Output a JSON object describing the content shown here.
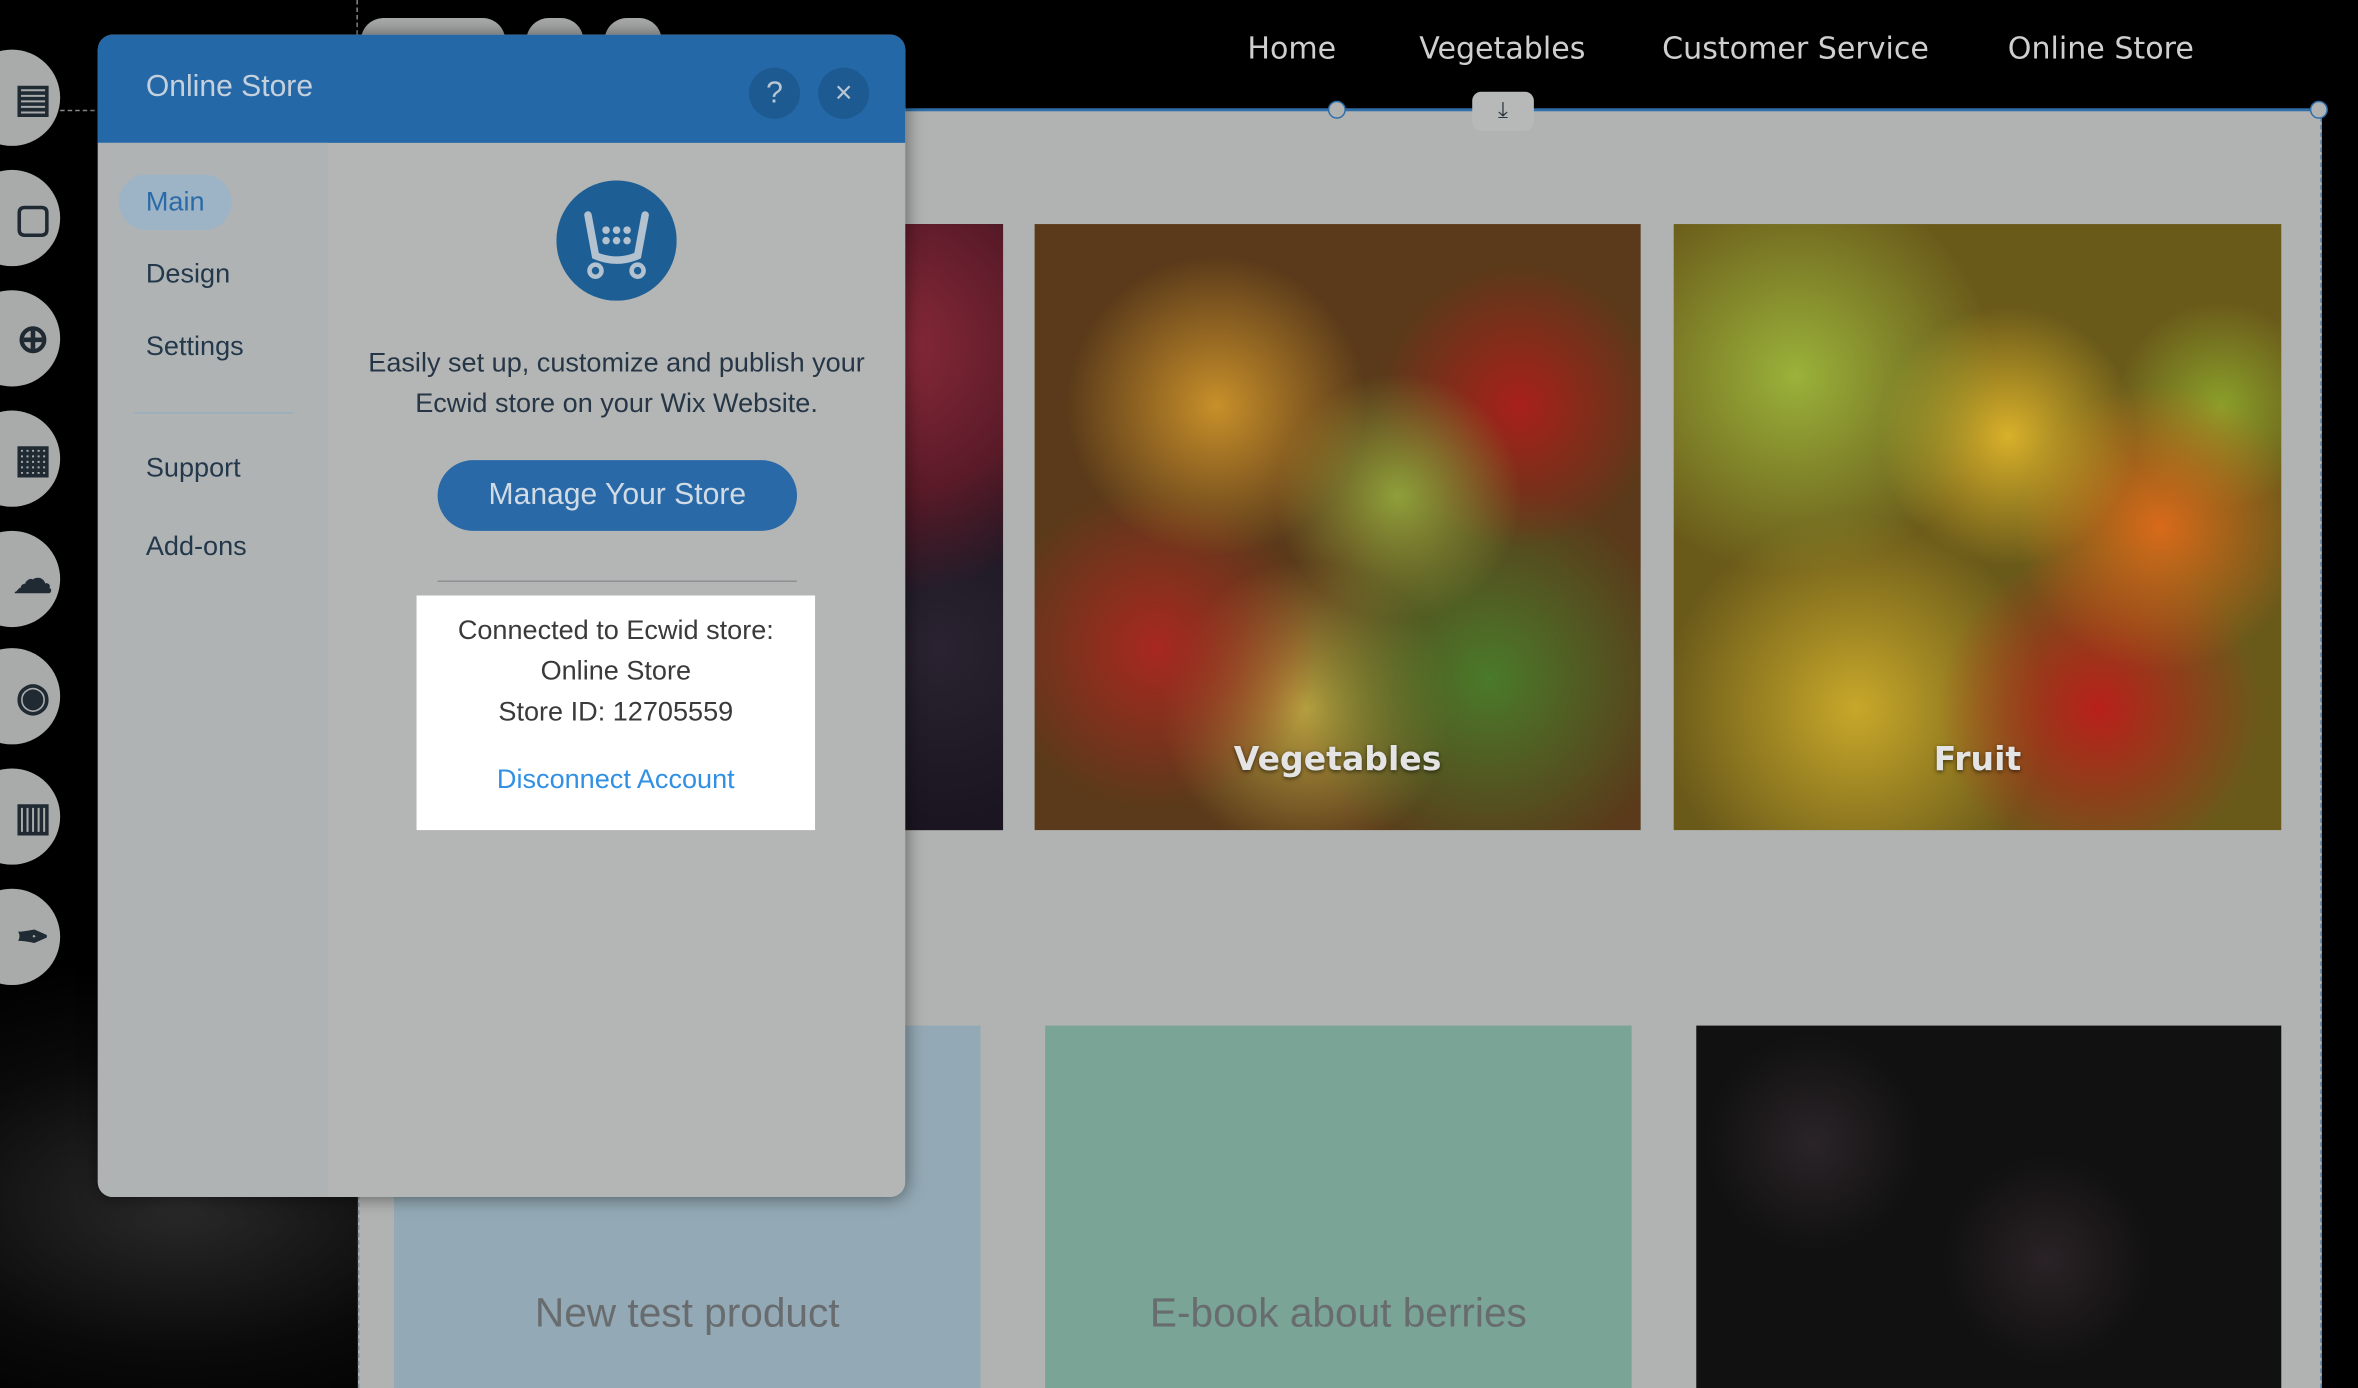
{
  "nav": {
    "items": [
      "Home",
      "Vegetables",
      "Customer Service",
      "Online Store"
    ]
  },
  "toolbar": {
    "icons": [
      "pages-icon",
      "background-icon",
      "add-icon",
      "apps-icon",
      "upload-icon",
      "media-icon",
      "calendar-icon",
      "pen-icon"
    ]
  },
  "gallery": {
    "items": [
      {
        "label": ""
      },
      {
        "label": "Vegetables"
      },
      {
        "label": "Fruit"
      }
    ]
  },
  "products": {
    "items": [
      {
        "label": "New test product"
      },
      {
        "label": "E-book about berries"
      },
      {
        "label": ""
      }
    ]
  },
  "dialog": {
    "title": "Online Store",
    "help": "?",
    "close": "×",
    "menu": [
      "Main",
      "Design",
      "Settings",
      "Support",
      "Add-ons"
    ],
    "active": "Main",
    "description": "Easily set up, customize and publish your Ecwid store on your Wix Website.",
    "manage_button": "Manage Your Store",
    "connected_label": "Connected to Ecwid store:",
    "store_name": "Online Store",
    "store_id": "Store ID: 12705559",
    "disconnect": "Disconnect Account"
  },
  "colors": {
    "accent": "#2468a7",
    "link": "#3190e3"
  }
}
